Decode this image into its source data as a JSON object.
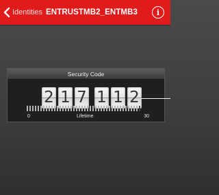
{
  "navbar": {
    "back_label": "Identities",
    "title": "ENTRUSTMB2_ENTMB3",
    "info_glyph": "i",
    "color": "#e01b1b"
  },
  "security_code": {
    "header": "Security Code",
    "digits": [
      "2",
      "1",
      "7",
      "1",
      "1",
      "2"
    ]
  },
  "lifetime": {
    "label": "Lifetime",
    "min": "0",
    "max": "30",
    "remaining_fraction": 0.97
  }
}
